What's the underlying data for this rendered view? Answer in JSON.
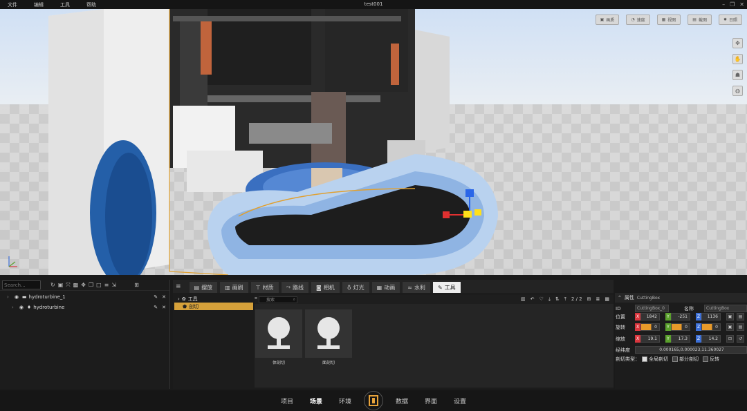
{
  "menu": [
    "文件",
    "编辑",
    "工具",
    "帮助"
  ],
  "window_title": "test001",
  "viewport": {
    "top_buttons": [
      {
        "icon": "image-icon",
        "label": "画质"
      },
      {
        "icon": "speed-icon",
        "label": "速度"
      },
      {
        "icon": "view-icon",
        "label": "视图"
      },
      {
        "icon": "screenshot-icon",
        "label": "截图"
      },
      {
        "icon": "sun-icon",
        "label": "日照"
      }
    ],
    "side_buttons": [
      "move-icon",
      "hand-icon",
      "walk-icon",
      "globe-icon"
    ]
  },
  "outliner": {
    "search_placeholder": "Search...",
    "rows": [
      {
        "name": "hydroturbine_1",
        "type": "group"
      },
      {
        "name": "hydroturbine",
        "type": "model"
      }
    ]
  },
  "tabs": [
    {
      "icon": "box-icon",
      "label": "摆放"
    },
    {
      "icon": "brush-icon",
      "label": "画刷"
    },
    {
      "icon": "material-icon",
      "label": "材质"
    },
    {
      "icon": "route-icon",
      "label": "路线"
    },
    {
      "icon": "camera-icon",
      "label": "相机"
    },
    {
      "icon": "bulb-icon",
      "label": "灯光"
    },
    {
      "icon": "film-icon",
      "label": "动画"
    },
    {
      "icon": "water-icon",
      "label": "水利"
    },
    {
      "icon": "wrench-icon",
      "label": "工具"
    }
  ],
  "active_tab": "工具",
  "category_tree": [
    {
      "label": "工具",
      "selected": false
    },
    {
      "label": "剖切",
      "selected": true
    }
  ],
  "asset_search_placeholder": "搜索",
  "page_indicator": "2 / 2",
  "assets": [
    {
      "label": "体剖切"
    },
    {
      "label": "面剖切"
    }
  ],
  "properties": {
    "title": "属性",
    "object": "CuttingBox",
    "id_label": "ID",
    "id_value": "CuttingBox_0",
    "name_label": "名称",
    "name_value": "CuttingBox",
    "position_label": "位置",
    "position": [
      "1842",
      "-251",
      "1136"
    ],
    "rotation_label": "旋转",
    "rotation": [
      "0",
      "0",
      "0"
    ],
    "scale_label": "缩放",
    "scale": [
      "19.1",
      "17.3",
      "14.2"
    ],
    "latlon_label": "经纬度",
    "latlon": "0.000165,0.000023,11.360027",
    "cut_type_label": "剖切类型：",
    "cut_options": [
      {
        "label": "全局剖切",
        "checked": true
      },
      {
        "label": "部分剖切",
        "checked": false
      },
      {
        "label": "反转",
        "checked": false
      }
    ],
    "colors": {
      "x": "#d9363e",
      "y": "#5aa02c",
      "z": "#3c6fd6",
      "rot": "#e89a2a"
    }
  },
  "bottom_nav": [
    "项目",
    "场景",
    "环境",
    "数据",
    "界面",
    "设置"
  ],
  "bottom_nav_active": "场景"
}
